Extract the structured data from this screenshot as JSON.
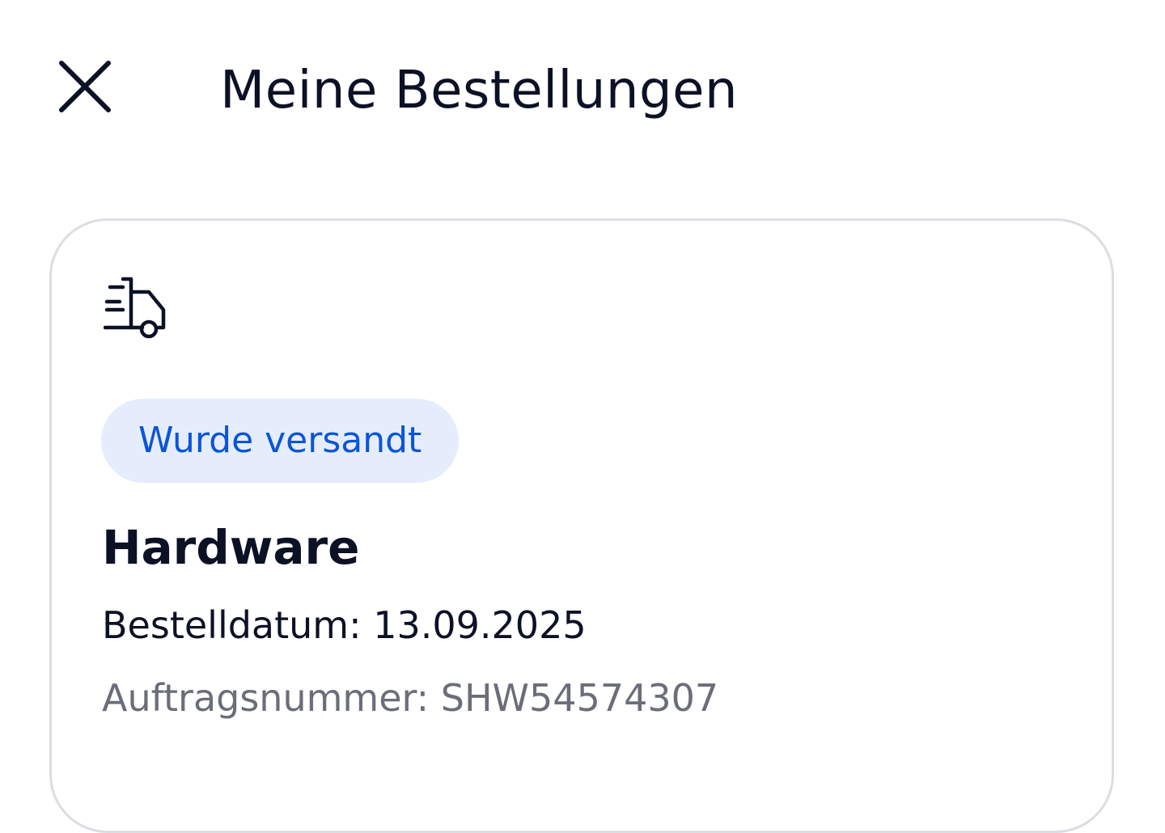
{
  "header": {
    "close_icon": "close-icon",
    "title": "Meine Bestellungen"
  },
  "order": {
    "icon": "delivery-truck-icon",
    "status": "Wurde versandt",
    "status_colors": {
      "background": "#e5edfd",
      "text": "#0b55d8"
    },
    "product": "Hardware",
    "order_date": "Bestelldatum: 13.09.2025",
    "order_number": "Auftragsnummer: SHW54574307"
  }
}
